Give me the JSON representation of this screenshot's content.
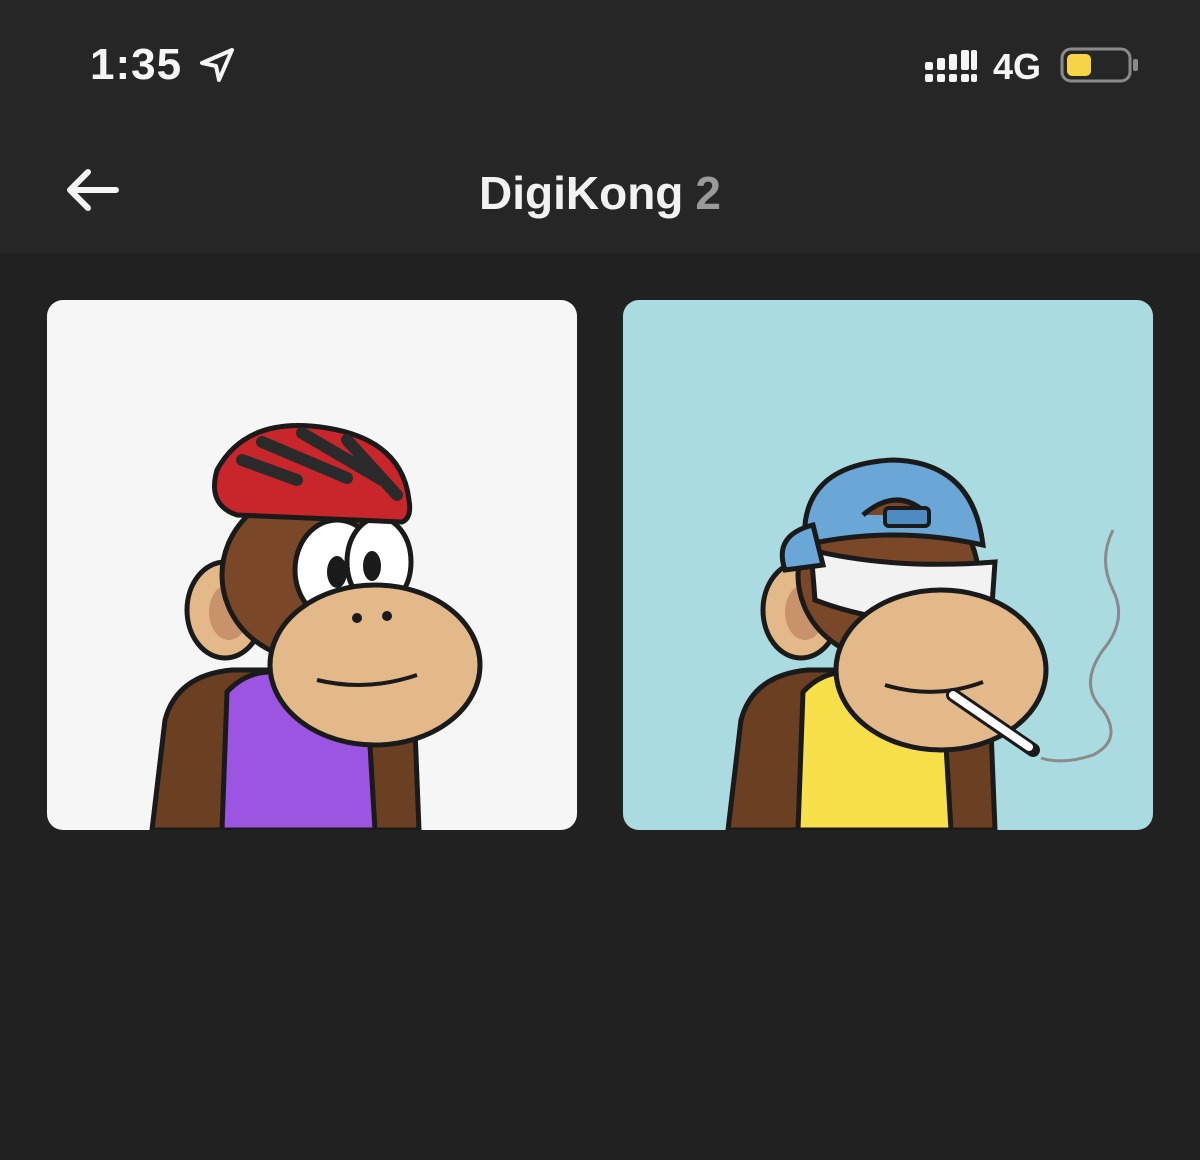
{
  "status_bar": {
    "time": "1:35",
    "network": "4G",
    "battery_color": "#f5d547"
  },
  "nav": {
    "title": "DigiKong",
    "count": "2"
  },
  "gallery": {
    "items": [
      {
        "background": "#f6f6f6",
        "shirt_color": "#9b55e0",
        "hat": "red-bike-helmet"
      },
      {
        "background": "#aadbe1",
        "shirt_color": "#f7e04a",
        "hat": "blue-backwards-cap"
      }
    ]
  }
}
